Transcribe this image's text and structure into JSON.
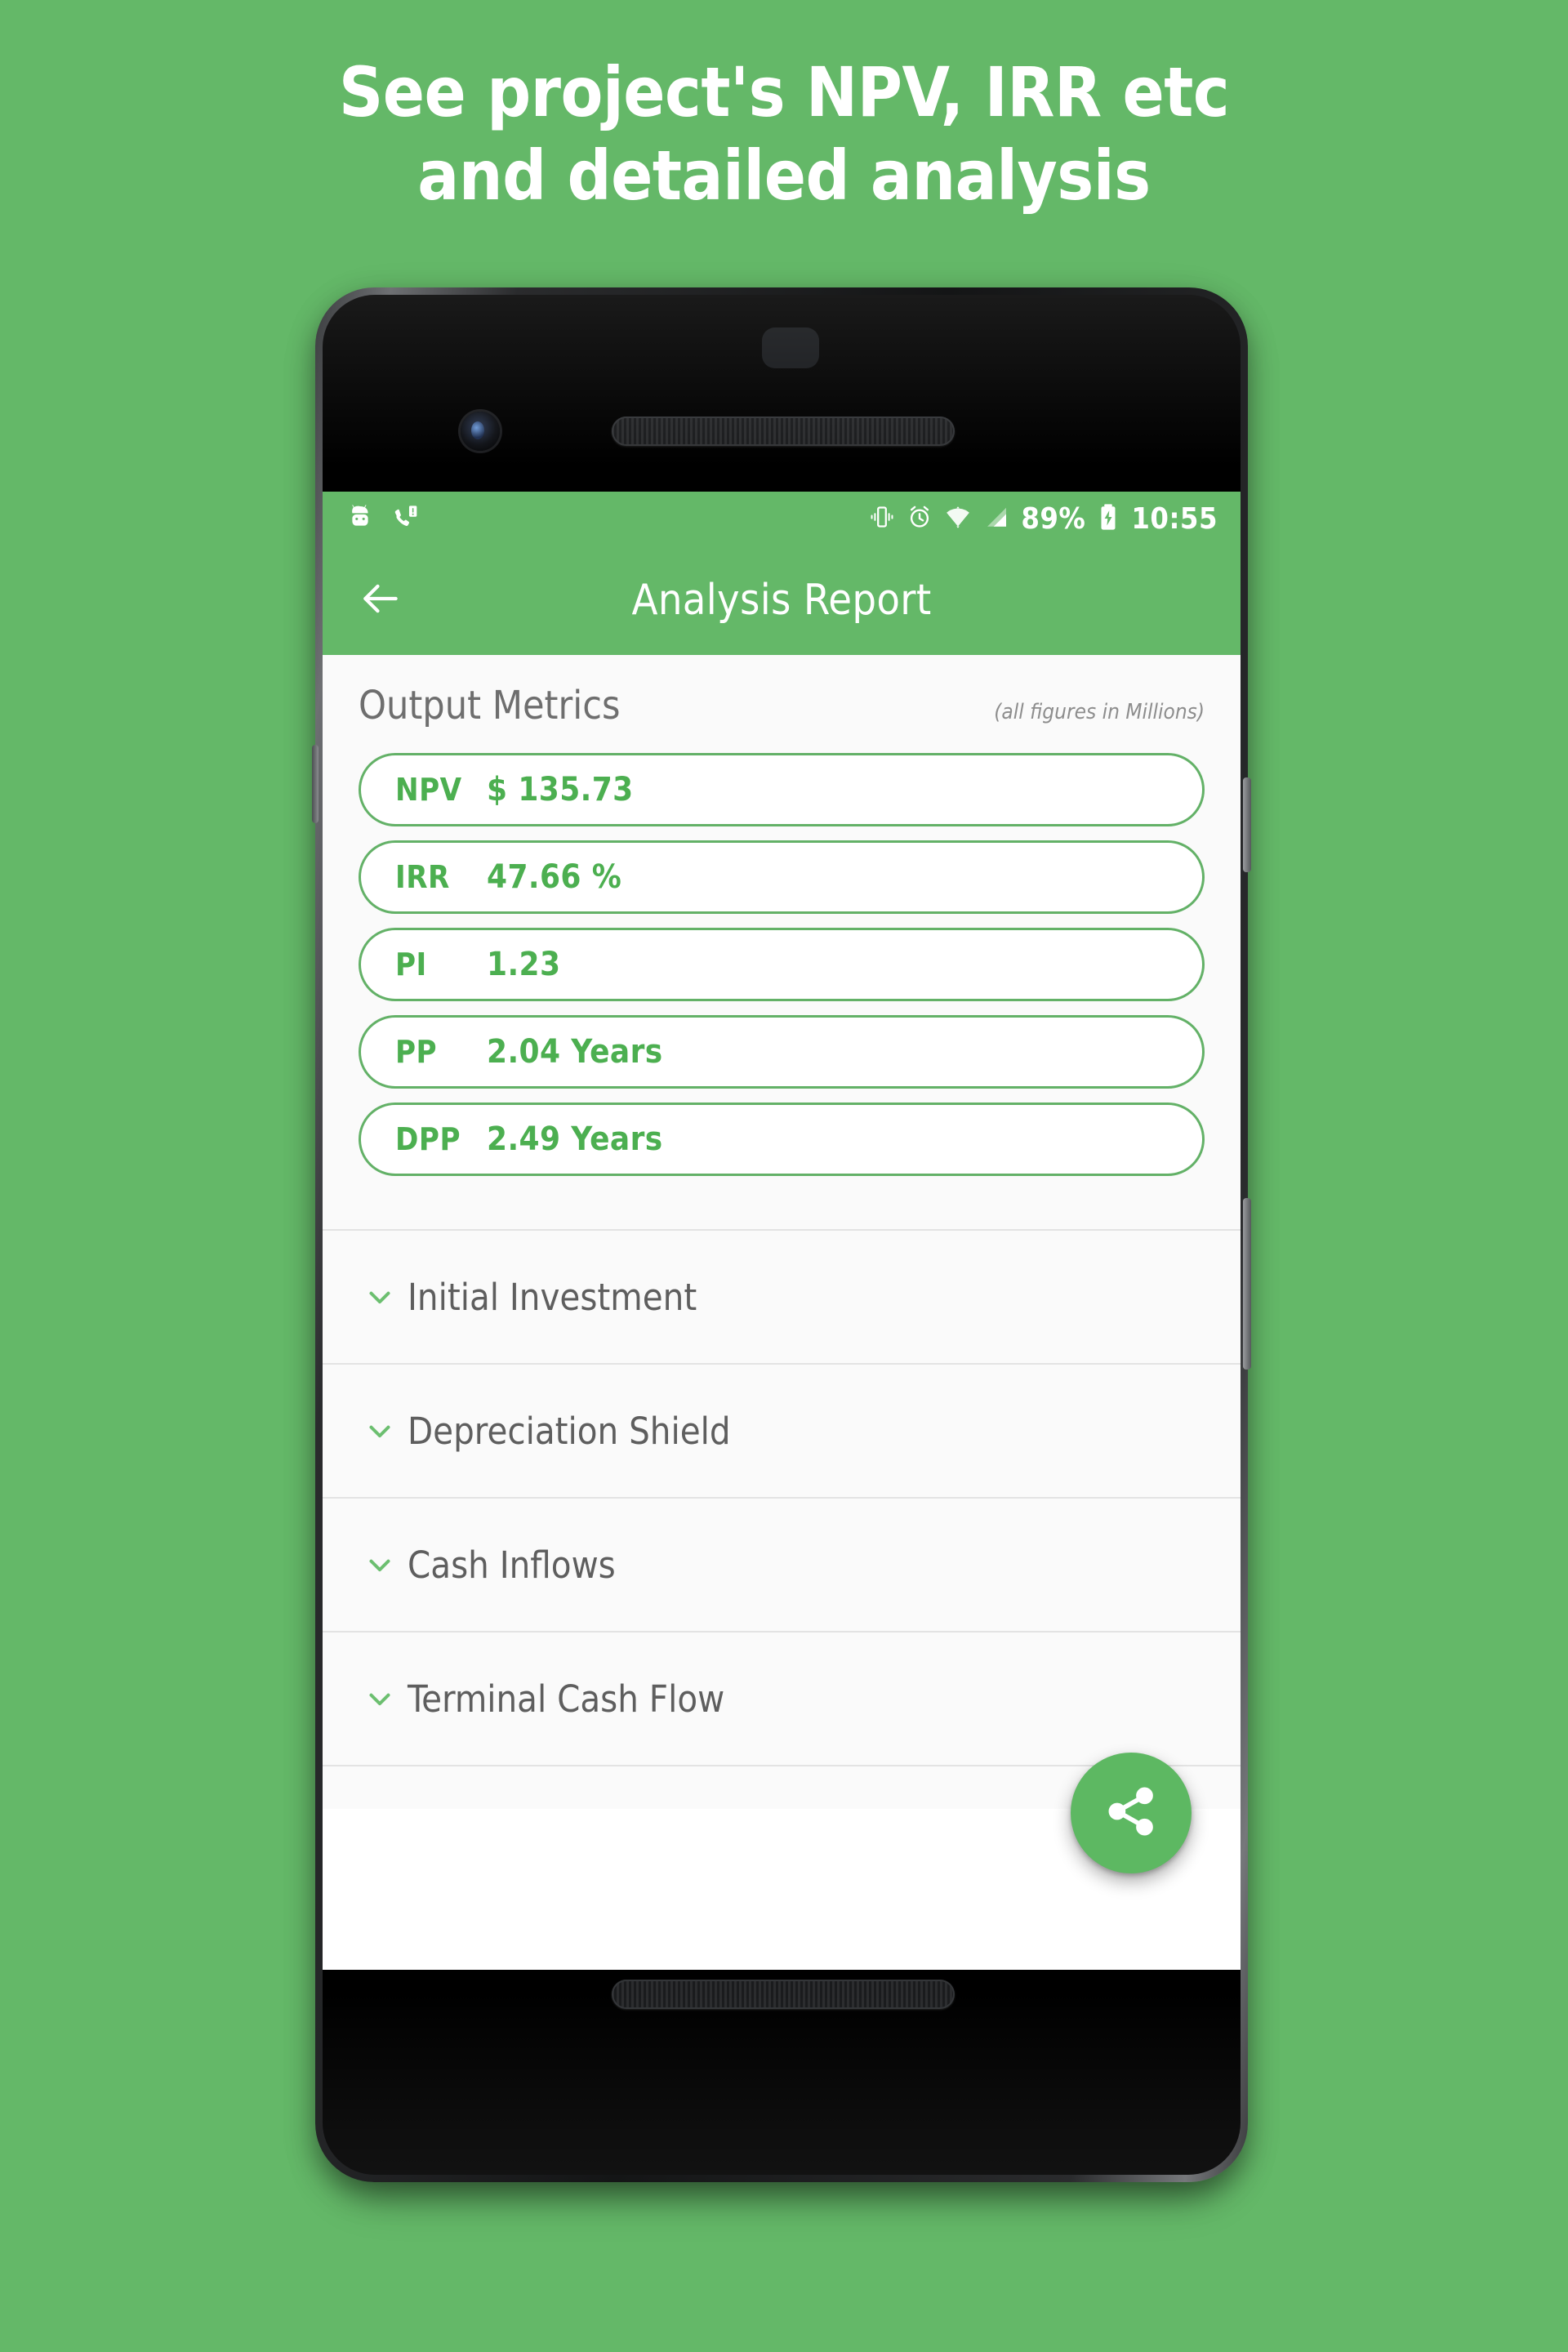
{
  "promo": {
    "line1": "See project's NPV, IRR etc",
    "line2": "and detailed analysis"
  },
  "colors": {
    "background_green": "#64b868",
    "appbar_green": "#64b868",
    "accent_green": "#4caf50",
    "pill_border_green": "#63b167",
    "fab_green": "#5db862",
    "panel_background": "#fafafa",
    "divider_grey": "#e3e3e3",
    "label_grey": "#5e5e5e"
  },
  "status_bar": {
    "left_icons": [
      "android-robot-icon",
      "missed-call-icon"
    ],
    "right_icons": [
      "vibrate-icon",
      "alarm-clock-icon",
      "wifi-icon",
      "cellular-signal-icon",
      "battery-charging-icon"
    ],
    "battery_percent": "89%",
    "time": "10:55"
  },
  "appbar": {
    "back_icon": "arrow-left-icon",
    "title": "Analysis Report"
  },
  "metrics_section": {
    "title": "Output Metrics",
    "note": "(all figures in Millions)",
    "metrics": [
      {
        "label": "NPV",
        "value": "$ 135.73"
      },
      {
        "label": "IRR",
        "value": "47.66 %"
      },
      {
        "label": "PI",
        "value": "1.23"
      },
      {
        "label": "PP",
        "value": "2.04 Years"
      },
      {
        "label": "DPP",
        "value": "2.49 Years"
      }
    ]
  },
  "accordion": {
    "chevron_icon": "chevron-down-icon",
    "items": [
      {
        "label": "Initial Investment"
      },
      {
        "label": "Depreciation Shield"
      },
      {
        "label": "Cash Inflows"
      },
      {
        "label": "Terminal Cash Flow"
      }
    ]
  },
  "fab": {
    "icon": "share-icon",
    "label": "Share"
  }
}
